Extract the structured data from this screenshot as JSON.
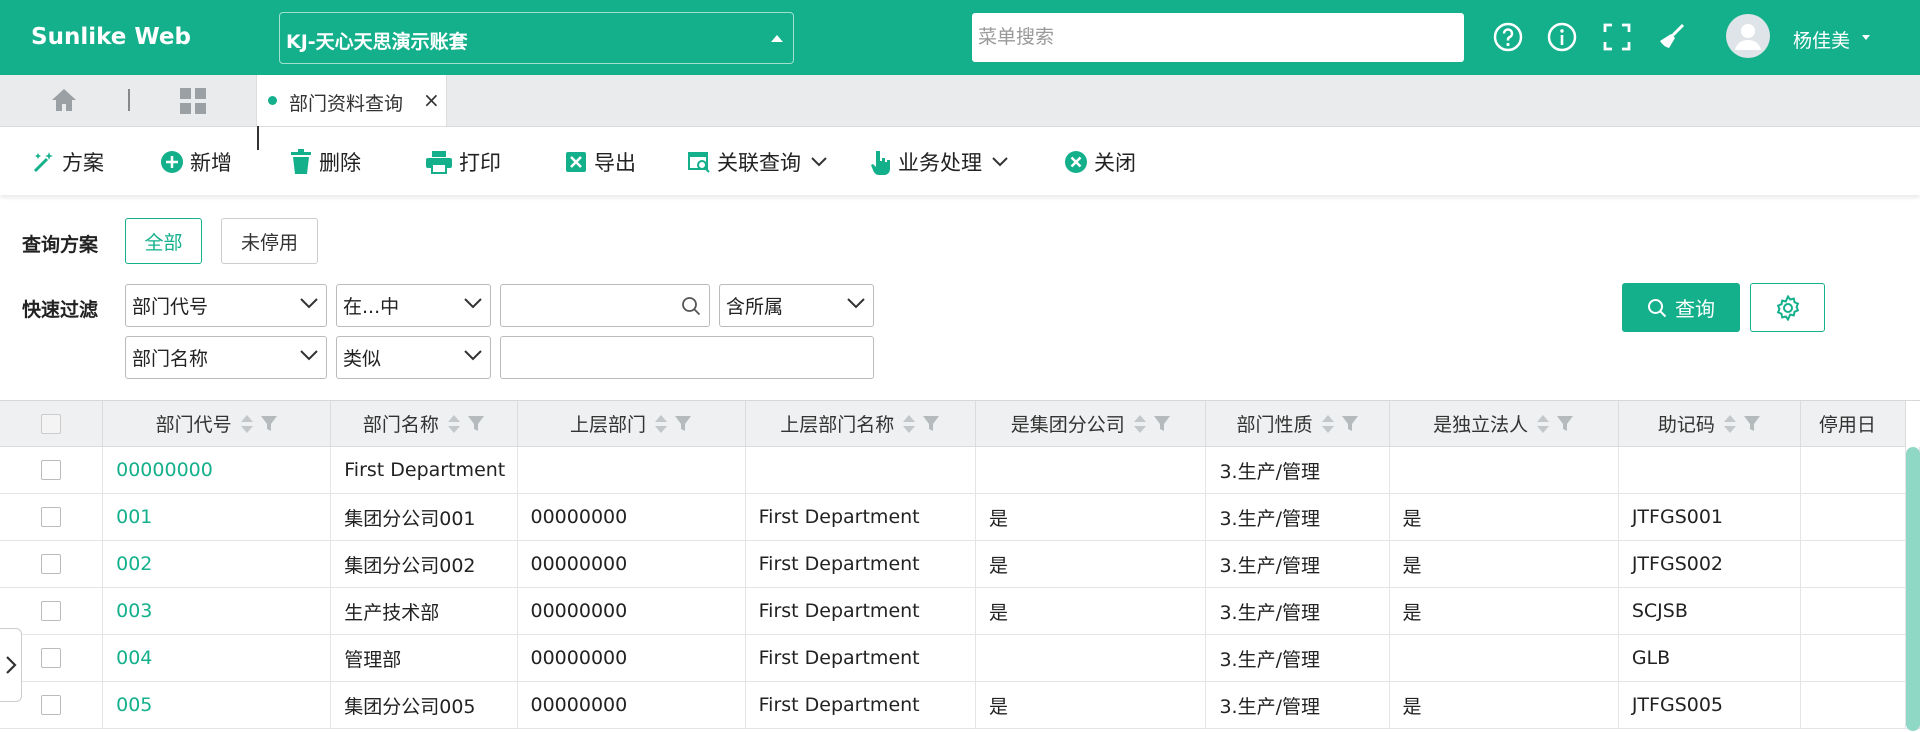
{
  "header": {
    "brand": "Sunlike Web",
    "account": "KJ-天心天思演示账套",
    "search_placeholder": "菜单搜索",
    "user_name": "杨佳美",
    "icons": [
      "help-icon",
      "info-icon",
      "fullscreen-icon",
      "broom-icon"
    ]
  },
  "tabs": {
    "active": "部门资料查询",
    "close": "×"
  },
  "toolbar": {
    "scheme": "方案",
    "add": "新增",
    "delete": "删除",
    "print": "打印",
    "export": "导出",
    "related_query": "关联查询",
    "business": "业务处理",
    "close": "关闭"
  },
  "filters": {
    "scheme_label": "查询方案",
    "scheme_all": "全部",
    "scheme_active": "未停用",
    "quick_label": "快速过滤",
    "row1": {
      "field": "部门代号",
      "operator": "在...中",
      "value": "",
      "scope": "含所属"
    },
    "row2": {
      "field": "部门名称",
      "operator": "类似",
      "value": ""
    },
    "query_button": "查询"
  },
  "table": {
    "columns": [
      "部门代号",
      "部门名称",
      "上层部门",
      "上层部门名称",
      "是集团分公司",
      "部门性质",
      "是独立法人",
      "助记码",
      "停用日"
    ],
    "rows": [
      [
        "00000000",
        "First Department",
        "",
        "",
        "",
        "3.生产/管理",
        "",
        "",
        ""
      ],
      [
        "001",
        "集团分公司001",
        "00000000",
        "First Department",
        "是",
        "3.生产/管理",
        "是",
        "JTFGS001",
        ""
      ],
      [
        "002",
        "集团分公司002",
        "00000000",
        "First Department",
        "是",
        "3.生产/管理",
        "是",
        "JTFGS002",
        ""
      ],
      [
        "003",
        "生产技术部",
        "00000000",
        "First Department",
        "是",
        "3.生产/管理",
        "是",
        "SCJSB",
        ""
      ],
      [
        "004",
        "管理部",
        "00000000",
        "First Department",
        "",
        "3.生产/管理",
        "",
        "GLB",
        ""
      ],
      [
        "005",
        "集团分公司005",
        "00000000",
        "First Department",
        "是",
        "3.生产/管理",
        "是",
        "JTFGS005",
        ""
      ]
    ]
  },
  "colors": {
    "brand": "#14b08c",
    "header_bg": "#14b08c",
    "link": "#14b08c"
  }
}
